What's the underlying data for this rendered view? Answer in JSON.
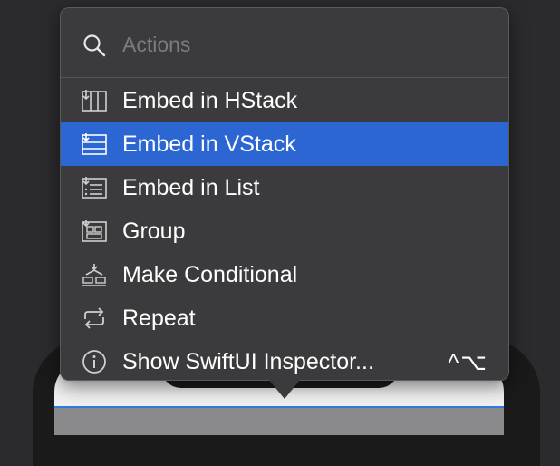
{
  "search": {
    "placeholder": "Actions"
  },
  "menu": {
    "items": [
      {
        "label": "Embed in HStack",
        "icon": "hstack-icon",
        "highlighted": false
      },
      {
        "label": "Embed in VStack",
        "icon": "vstack-icon",
        "highlighted": true
      },
      {
        "label": "Embed in List",
        "icon": "list-icon",
        "highlighted": false
      },
      {
        "label": "Group",
        "icon": "group-icon",
        "highlighted": false
      },
      {
        "label": "Make Conditional",
        "icon": "conditional-icon",
        "highlighted": false
      },
      {
        "label": "Repeat",
        "icon": "repeat-icon",
        "highlighted": false
      },
      {
        "label": "Show SwiftUI Inspector...",
        "icon": "info-icon",
        "highlighted": false,
        "shortcut": "^⌥"
      }
    ]
  },
  "colors": {
    "highlight": "#2b66d2",
    "popover_bg": "#3b3b3d",
    "selection_border": "#2f7be0"
  }
}
